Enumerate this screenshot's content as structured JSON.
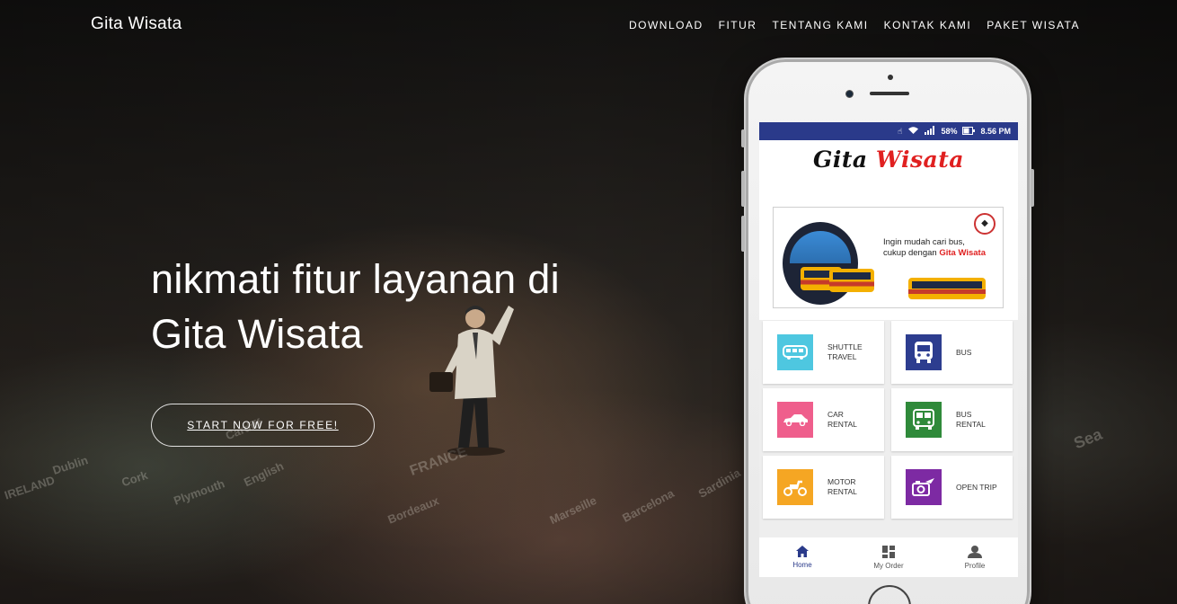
{
  "site": {
    "brand": "Gita Wisata",
    "nav": [
      "DOWNLOAD",
      "FITUR",
      "TENTANG KAMI",
      "KONTAK KAMI",
      "PAKET WISATA"
    ]
  },
  "hero": {
    "headline_line1": "nikmati fitur layanan di",
    "headline_line2": "Gita Wisata",
    "cta": "START NOW FOR FREE!"
  },
  "background_map_labels": [
    "Dublin",
    "IRELAND",
    "Cork",
    "Plymouth",
    "English",
    "Cardiff",
    "FRANCE",
    "Bordeaux",
    "Marseille",
    "Barcelona",
    "Sardinia",
    "Sea"
  ],
  "phone_app": {
    "status": {
      "battery": "58%",
      "time": "8.56 PM"
    },
    "title_part1": "Gita",
    "title_part2": "Wisata",
    "banner": {
      "line1": "Ingin mudah cari bus,",
      "line2_prefix": "cukup dengan",
      "line2_brand": "Gita Wisata"
    },
    "tiles": [
      {
        "label": "SHUTTLE\nTRAVEL",
        "color": "#4ec7e0",
        "icon": "shuttle-icon"
      },
      {
        "label": "BUS",
        "color": "#2d3d8f",
        "icon": "bus-icon"
      },
      {
        "label": "CAR\nRENTAL",
        "color": "#ef5e8c",
        "icon": "car-icon"
      },
      {
        "label": "BUS\nRENTAL",
        "color": "#2f8a3a",
        "icon": "bus-rental-icon"
      },
      {
        "label": "MOTOR\nRENTAL",
        "color": "#f5a623",
        "icon": "scooter-icon"
      },
      {
        "label": "OPEN TRIP",
        "color": "#7d2aa3",
        "icon": "open-trip-icon"
      }
    ],
    "bottom_nav": [
      "Home",
      "My Order",
      "Profile"
    ]
  },
  "colors": {
    "status_bar": "#2a3a8a",
    "title_accent": "#e02020"
  }
}
